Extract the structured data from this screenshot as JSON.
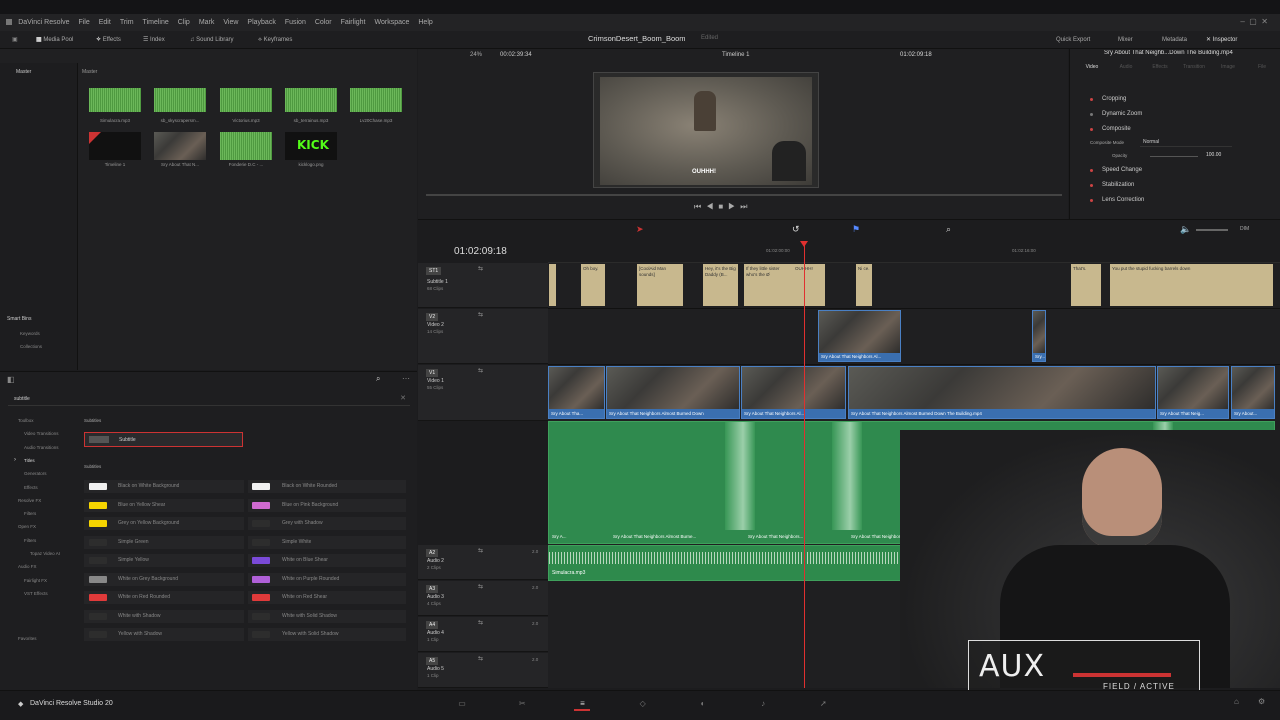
{
  "app": {
    "title": "DaVinci Resolve",
    "project": "CrimsonDesert_Boom_Boom",
    "project_status": "Edited",
    "footer": "DaVinci Resolve Studio 20"
  },
  "menu": [
    "DaVinci Resolve",
    "File",
    "Edit",
    "Trim",
    "Timeline",
    "Clip",
    "Mark",
    "View",
    "Playback",
    "Fusion",
    "Color",
    "Fairlight",
    "Workspace",
    "Help"
  ],
  "toolbar": {
    "media_pool": "Media Pool",
    "effects": "Effects",
    "index": "Index",
    "sound_library": "Sound Library",
    "keyframes": "Keyframes",
    "zoom": "24%",
    "timecode_src": "00:02:39:34",
    "timeline_name": "Timeline 1",
    "timecode_rec": "01:02:09:18",
    "quick_export": "Quick Export",
    "mixer": "Mixer",
    "metadata": "Metadata",
    "inspector": "Inspector"
  },
  "media_pool": {
    "master_label": "Master",
    "master_tab": "Master",
    "smart_bins": "Smart Bins",
    "keywords": "Keywords",
    "collections": "Collections",
    "items": [
      {
        "name": "Simulacra.mp3"
      },
      {
        "name": "sb_skyscrapersm..."
      },
      {
        "name": "Victorius.mp3"
      },
      {
        "name": "sb_terrainus.mp3"
      },
      {
        "name": "Lv20Chase.mp3"
      },
      {
        "name": "Timeline 1"
      },
      {
        "name": "Sry About That N..."
      },
      {
        "name": "Fonderie D.C - ..."
      },
      {
        "name": "kicklogo.png"
      }
    ],
    "kick_logo": "KICK"
  },
  "effects": {
    "search": "subtitle",
    "categories": [
      "Toolbox",
      "Video Transitions",
      "Audio Transitions",
      "Titles",
      "Generators",
      "Effects",
      "Resolve FX",
      "Filters",
      "Open FX",
      "Filters",
      "Topaz Video AI",
      "Audio FX",
      "Fairlight FX",
      "VST Effects"
    ],
    "favorites": "Favorites",
    "subtitles_heading": "Subtitles",
    "selected": "Subtitle",
    "subtitles_heading2": "Subtitles",
    "presets_left": [
      "Black on White Background",
      "Blue on Yellow Shear",
      "Grey on Yellow Background",
      "Simple Green",
      "Simple Yellow",
      "White on Grey Background",
      "White on Red Rounded",
      "White with Shadow",
      "Yellow with Shadow"
    ],
    "presets_right": [
      "Black on White Rounded",
      "Blue on Pink Background",
      "Grey with Shadow",
      "Simple White",
      "White on Blue Shear",
      "White on Purple Rounded",
      "White on Red Shear",
      "White with Solid Shadow",
      "Yellow with Solid Shadow"
    ],
    "left_colors": [
      "#f0f0f0",
      "#f5d400",
      "#f5d400",
      "#2d2d2d",
      "#2d2d2d",
      "#888888",
      "#e03a3a",
      "#2d2d2d",
      "#2d2d2d"
    ],
    "right_colors": [
      "#f0f0f0",
      "#d06ad0",
      "#2d2d2d",
      "#2d2d2d",
      "#7a4ad8",
      "#b060d8",
      "#e03a3a",
      "#2d2d2d",
      "#2d2d2d"
    ]
  },
  "viewer": {
    "caption": "OUHHH!"
  },
  "timeline": {
    "timecode": "01:02:09:18",
    "ruler": [
      "01:02:00:00",
      "01:02:16:00"
    ],
    "tracks": [
      {
        "id": "ST1",
        "name": "Subtitle 1",
        "count": "68 Clips"
      },
      {
        "id": "V2",
        "name": "Video 2",
        "count": "14 Clips"
      },
      {
        "id": "V1",
        "name": "Video 1",
        "count": "55 Clips"
      },
      {
        "id": "A2",
        "name": "Audio 2",
        "count": "2 Clips",
        "level": "2.0"
      },
      {
        "id": "A3",
        "name": "Audio 3",
        "count": "4 Clips",
        "level": "2.0"
      },
      {
        "id": "A4",
        "name": "Audio 4",
        "count": "1 Clip",
        "level": "2.0"
      },
      {
        "id": "A5",
        "name": "Audio 5",
        "count": "1 Clip",
        "level": "2.0"
      }
    ],
    "subtitles": [
      "Oh boy.",
      "[CoolAid Man sounds]",
      "Hey, it's the Big Daddy (B...",
      "If they little sister who's the Ø",
      "OUHHH!",
      "Ni ce.",
      "That's.",
      "You put the stupid fucking barrels down"
    ],
    "v2_clips": [
      "Sry About That Neighbors Al...",
      "Sry..."
    ],
    "v1_clips": [
      "Sry About Tha...",
      "Sry About That Neighbors Almost Burned Down",
      "Sry About That Neighbors Al...",
      "Sry About That Neighbors Almost Burned Down The Building.mp4",
      "Sry About That Neig...",
      "Sry About..."
    ],
    "a1_clips": [
      "Sry A...",
      "Sry About That Neighbors Almost Burne...",
      "Sry About That Neighbors...",
      "Sry About That Neighbors Almost Burned Down The Building.mp4",
      "Sry About T..."
    ],
    "a2_clip": "Simulacra.mp3",
    "dim": "DIM"
  },
  "inspector": {
    "file": "Sry About That Neighb...Down The Building.mp4",
    "tabs": [
      "Video",
      "Audio",
      "Effects",
      "Transition",
      "Image",
      "File"
    ],
    "rows": [
      "Cropping",
      "Dynamic Zoom",
      "Composite",
      "Speed Change",
      "Stabilization",
      "Lens Correction"
    ],
    "composite_mode_label": "Composite Mode",
    "composite_mode": "Normal",
    "opacity_label": "Opacity",
    "opacity": "100.00"
  },
  "overlay": {
    "aux": "AUX",
    "status": "FIELD / ACTIVE"
  }
}
